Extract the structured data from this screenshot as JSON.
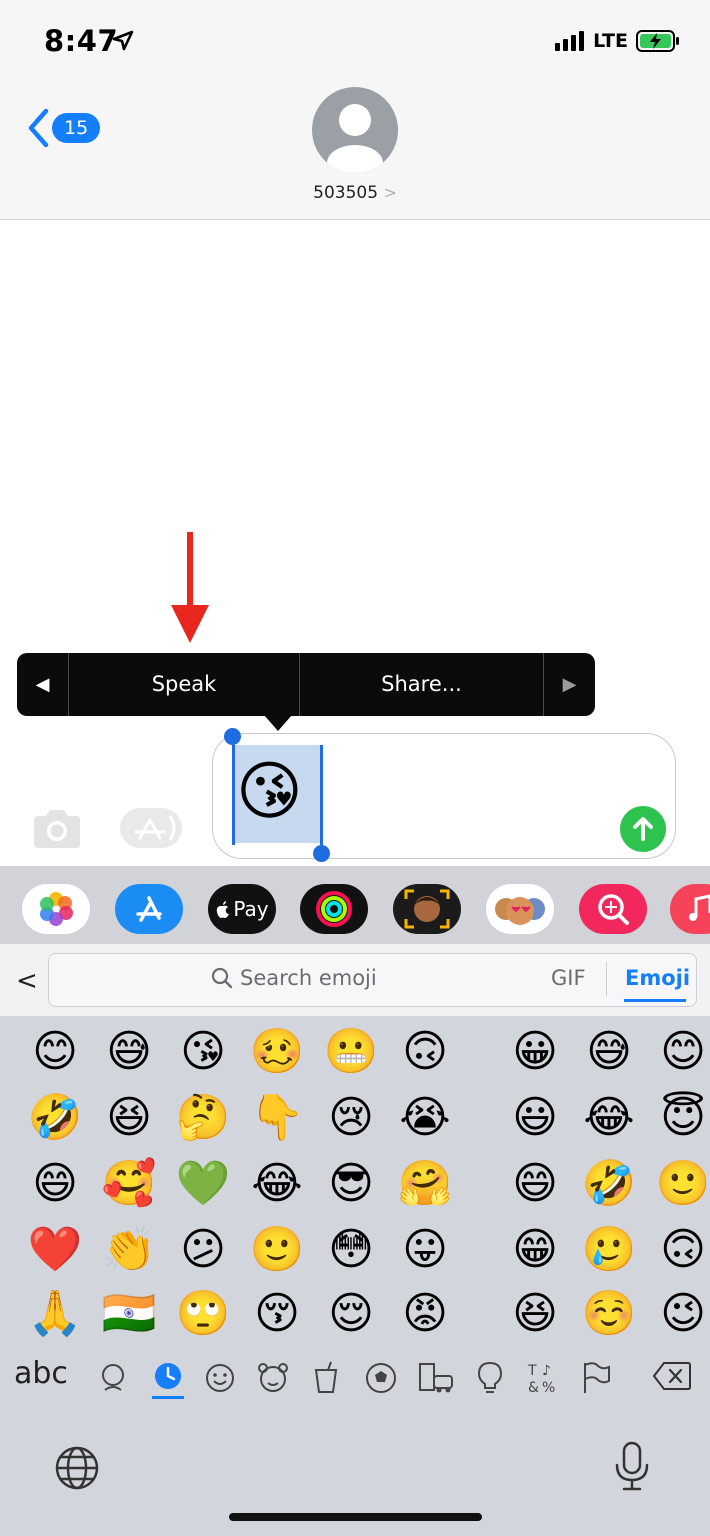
{
  "status_bar": {
    "time": "8:47",
    "network": "LTE"
  },
  "header": {
    "back_badge": "15",
    "contact_name": "503505",
    "contact_chevron": ">"
  },
  "callout_menu": {
    "left_arrow": "◀",
    "speak": "Speak",
    "share": "Share...",
    "right_arrow": "▶"
  },
  "composer": {
    "selected_emoji": "😘"
  },
  "app_drawer": {
    "apple_pay_label": "Pay"
  },
  "emoji_keyboard": {
    "search_placeholder": "Search emoji",
    "gif_tab": "GIF",
    "emoji_tab": "Emoji",
    "back_chevron": "<",
    "abc_label": "abc",
    "rows": [
      [
        "😊",
        "😅",
        "😘",
        "🥴",
        "😬",
        "🙃",
        "😀",
        "😅",
        "😊"
      ],
      [
        "🤣",
        "😆",
        "🤔",
        "👇",
        "😢",
        "😭",
        "😃",
        "😂",
        "😇"
      ],
      [
        "😄",
        "🥰",
        "💚",
        "😂",
        "😎",
        "🤗",
        "😄",
        "🤣",
        "🙂"
      ],
      [
        "❤️",
        "👏",
        "😕",
        "🙂",
        "😳",
        "😛",
        "😁",
        "🥲",
        "🙃"
      ],
      [
        "🙏",
        "🇮🇳",
        "🙄",
        "😚",
        "😌",
        "😡",
        "😆",
        "☺️",
        "😉"
      ]
    ]
  },
  "colors": {
    "accent": "#157efb",
    "send": "#2ec34e",
    "arrow": "#e8281f",
    "menu_bg": "#0b0b0b"
  }
}
